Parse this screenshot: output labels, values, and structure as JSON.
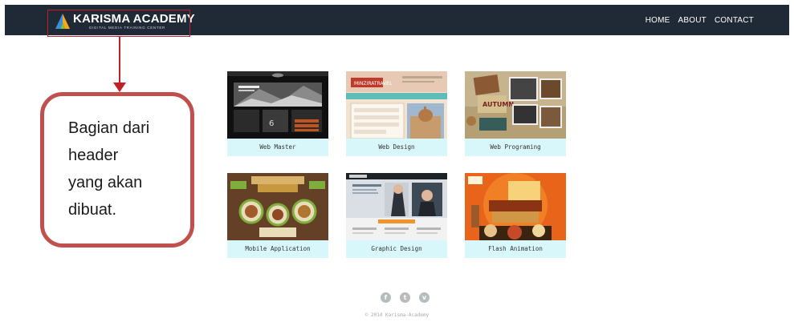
{
  "header": {
    "logo_title": "KARISMA ACADEMY",
    "logo_tagline": "DIGITAL MEDIA TRAINING CENTER",
    "nav": [
      "HOME",
      "ABOUT",
      "CONTACT"
    ]
  },
  "annotation": {
    "callout_lines": [
      "Bagian dari",
      "header",
      "yang akan",
      "dibuat."
    ]
  },
  "gallery": [
    {
      "caption": "Web Master",
      "theme": "dark-photo"
    },
    {
      "caption": "Web Design",
      "theme": "travel-site"
    },
    {
      "caption": "Web Programing",
      "theme": "autumn-scrapbook"
    },
    {
      "caption": "Mobile Application",
      "theme": "wooden-menu"
    },
    {
      "caption": "Graphic Design",
      "theme": "business-site"
    },
    {
      "caption": "Flash Animation",
      "theme": "food-orange"
    }
  ],
  "footer": {
    "social_icons": [
      "facebook-icon",
      "twitter-icon",
      "vimeo-icon"
    ],
    "social_glyphs": [
      "f",
      "t",
      "v"
    ],
    "copyright": "© 2014 Karisma-Academy"
  },
  "colors": {
    "header_bg": "#1f2a36",
    "annotation_red": "#c0202a",
    "callout_border": "#c0504d",
    "caption_bg": "#d8f7fb"
  }
}
